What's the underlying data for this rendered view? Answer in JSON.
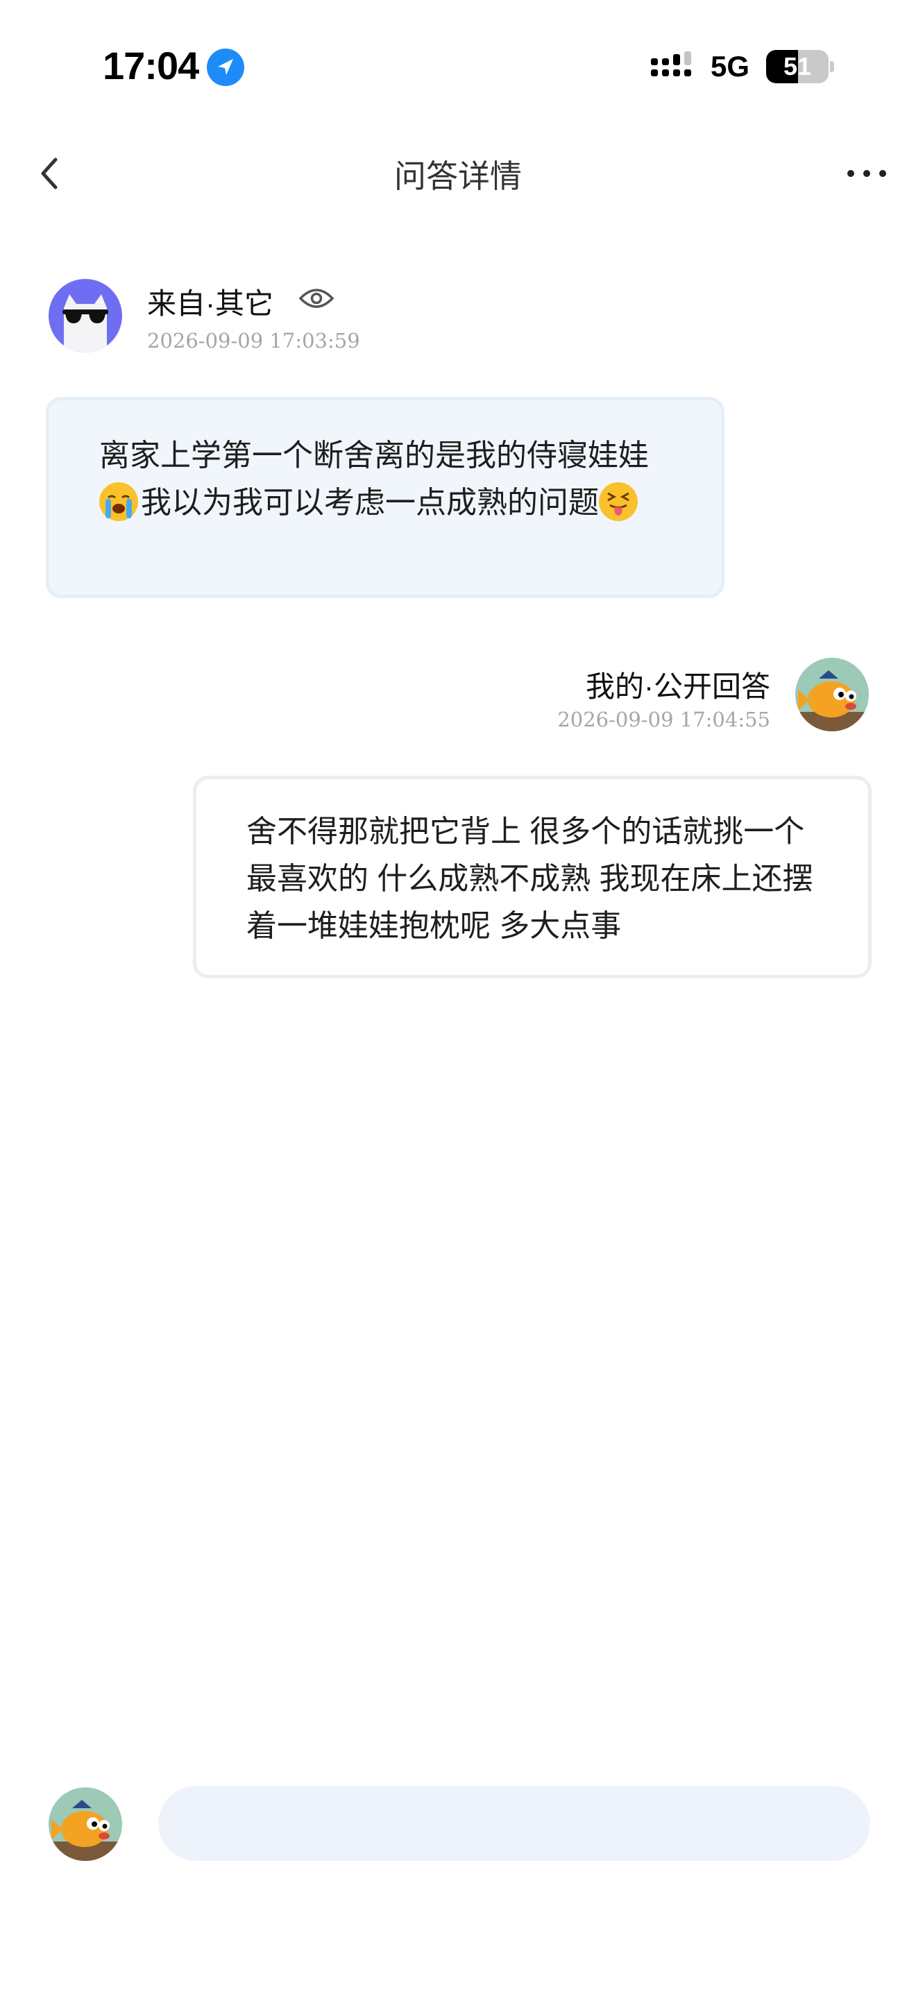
{
  "status_bar": {
    "time": "17:04",
    "network": "5G",
    "battery": "51",
    "battery_level_percent": 51
  },
  "nav": {
    "title": "问答详情"
  },
  "question": {
    "asker_label": "来自·其它",
    "timestamp": "2026-09-09 17:03:59",
    "text_part1": "离家上学第一个断舍离的是我的侍寝娃娃",
    "text_part2": "我以为我可以考虑一点成熟的问题",
    "emoji_1": "loudly-crying-face",
    "emoji_2": "squinting-face-with-tongue"
  },
  "answer": {
    "answerer_label": "我的·公开回答",
    "timestamp": "2026-09-09 17:04:55",
    "text": "舍不得那就把它背上 很多个的话就挑一个最喜欢的 什么成熟不成熟 我现在床上还摆着一堆娃娃抱枕呢 多大点事"
  },
  "reply": {
    "placeholder": ""
  },
  "colors": {
    "accent_blue": "#1d8cf8",
    "asker_avatar_bg": "#6f6ef2",
    "question_bubble_bg": "#f1f6fc",
    "input_bg": "#eef3fb",
    "timestamp_gray": "#a6a6aa"
  }
}
